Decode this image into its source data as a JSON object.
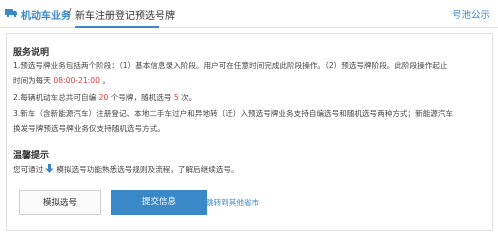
{
  "header": {
    "brand": "机动车业务",
    "separator": "/",
    "subtitle": "新车注册登记预选号牌",
    "notice_link": "号池公示"
  },
  "service_info": {
    "title": "服务说明",
    "line1": "1.预选号牌业务包括两个阶段：（1）基本信息录入阶段。用户可在任意时间完成此阶段操作。（2）预选号牌阶段。此阶段操作起止",
    "line2_prefix": "时间为每天",
    "line2_time": "08:00-21:00",
    "line2_suffix": "。",
    "line3_a": "2.每辆机动车总共可自编",
    "line3_count": "20",
    "line3_b": "个号牌，随机选号",
    "line3_times": "5",
    "line3_c": "次。",
    "line4": "3.新车（含新能源汽车）注册登记、本地二手车过户和异地转（迁）入预选号牌业务支持自编选号和随机选号两种方式；新能源汽车",
    "line5": "换发号牌预选号牌业务仅支持随机选号方式。"
  },
  "tips": {
    "title": "温馨提示",
    "text_a": "您可通过",
    "text_b": "模拟选号功能熟悉选号规则及流程，了解后继续选号。"
  },
  "actions": {
    "mock_button": "模拟选号",
    "submit_button": "提交信息",
    "other_city_link": "跳转到其他省市"
  },
  "colors": {
    "accent": "#3a88c8",
    "highlight": "#e23b3b"
  },
  "icons": {
    "brand": "car-icon",
    "tip": "down-arrow-icon"
  }
}
